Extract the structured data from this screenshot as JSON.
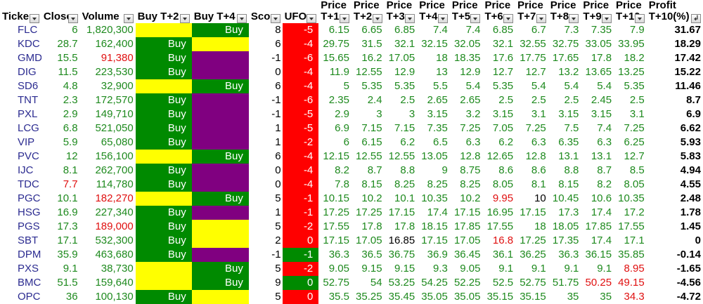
{
  "colors": {
    "buy_green": "#008a00",
    "empty_yellow": "#ffff00",
    "sell_purple": "#800080",
    "ufo_red": "#ff0000",
    "value_green": "#1e8a1e",
    "value_red": "#e01010"
  },
  "headers": {
    "ticker": "Ticker",
    "close": "Close",
    "volume": "Volume",
    "buy_t2": "Buy T+2",
    "buy_t4": "Buy T+4",
    "score": "Score",
    "ufo": "UFO",
    "price_top": "Price",
    "t1": "T+1",
    "t2": "T+2",
    "t3": "T+3",
    "t4": "T+4",
    "t5": "T+5",
    "t6": "T+6",
    "t7": "T+7",
    "t8": "T+8",
    "t9": "T+9",
    "t10": "T+10",
    "profit_top": "Profit",
    "profit_bottom": "T+10(%)"
  },
  "rows": [
    {
      "ticker": "FLC",
      "close": "6",
      "volume": "1,820,300",
      "b2": "",
      "b2c": "yellow",
      "b4": "Buy",
      "b4c": "green",
      "score": "8",
      "ufo": "-5",
      "ufoc": "red",
      "p": [
        "6.15",
        "6.65",
        "6.85",
        "7.4",
        "7.4",
        "6.85",
        "6.7",
        "7.3",
        "7.35",
        "7.9"
      ],
      "profit": "31.67"
    },
    {
      "ticker": "KDC",
      "close": "28.7",
      "volume": "162,400",
      "b2": "Buy",
      "b2c": "green",
      "b4": "",
      "b4c": "yellow",
      "score": "6",
      "ufo": "-4",
      "ufoc": "red",
      "p": [
        "29.75",
        "31.5",
        "32.1",
        "32.15",
        "32.05",
        "32.1",
        "32.55",
        "32.75",
        "33.05",
        "33.95"
      ],
      "profit": "18.29"
    },
    {
      "ticker": "GMD",
      "close": "15.5",
      "volume": "91,380",
      "volc": "red",
      "b2": "Buy",
      "b2c": "green",
      "b4": "",
      "b4c": "purple",
      "score": "-1",
      "ufo": "-6",
      "ufoc": "red",
      "p": [
        "15.65",
        "16.2",
        "17.05",
        "18",
        "18.35",
        "17.6",
        "17.75",
        "17.65",
        "17.8",
        "18.2"
      ],
      "profit": "17.42"
    },
    {
      "ticker": "DIG",
      "close": "11.5",
      "volume": "223,530",
      "b2": "Buy",
      "b2c": "green",
      "b4": "",
      "b4c": "purple",
      "score": "0",
      "ufo": "-4",
      "ufoc": "red",
      "p": [
        "11.9",
        "12.55",
        "12.9",
        "13",
        "12.9",
        "12.7",
        "12.7",
        "13.2",
        "13.65",
        "13.25"
      ],
      "profit": "15.22"
    },
    {
      "ticker": "SD6",
      "close": "4.8",
      "volume": "32,900",
      "b2": "",
      "b2c": "yellow",
      "b4": "Buy",
      "b4c": "green",
      "score": "6",
      "ufo": "-4",
      "ufoc": "red",
      "p": [
        "5",
        "5.35",
        "5.35",
        "5.5",
        "5.4",
        "5.35",
        "5.4",
        "5.4",
        "5.4",
        "5.35"
      ],
      "profit": "11.46"
    },
    {
      "ticker": "TNT",
      "close": "2.3",
      "volume": "172,570",
      "b2": "Buy",
      "b2c": "green",
      "b4": "",
      "b4c": "purple",
      "score": "-1",
      "ufo": "-6",
      "ufoc": "red",
      "p": [
        "2.35",
        "2.4",
        "2.5",
        "2.65",
        "2.65",
        "2.5",
        "2.5",
        "2.5",
        "2.45",
        "2.5"
      ],
      "profit": "8.7"
    },
    {
      "ticker": "PXL",
      "close": "2.9",
      "volume": "149,710",
      "b2": "Buy",
      "b2c": "green",
      "b4": "",
      "b4c": "purple",
      "score": "-1",
      "ufo": "-5",
      "ufoc": "red",
      "p": [
        "2.9",
        "3",
        "3",
        "3.15",
        "3.2",
        "3.15",
        "3.1",
        "3.15",
        "3.15",
        "3.1"
      ],
      "profit": "6.9"
    },
    {
      "ticker": "LCG",
      "close": "6.8",
      "volume": "521,050",
      "b2": "Buy",
      "b2c": "green",
      "b4": "",
      "b4c": "purple",
      "score": "1",
      "ufo": "-5",
      "ufoc": "red",
      "p": [
        "6.9",
        "7.15",
        "7.15",
        "7.35",
        "7.25",
        "7.05",
        "7.25",
        "7.5",
        "7.4",
        "7.25"
      ],
      "profit": "6.62"
    },
    {
      "ticker": "VIP",
      "close": "5.9",
      "volume": "65,080",
      "b2": "Buy",
      "b2c": "green",
      "b4": "",
      "b4c": "purple",
      "score": "1",
      "ufo": "-2",
      "ufoc": "red",
      "p": [
        "6",
        "6.15",
        "6.2",
        "6.5",
        "6.3",
        "6.2",
        "6.3",
        "6.35",
        "6.3",
        "6.25"
      ],
      "profit": "5.93"
    },
    {
      "ticker": "PVC",
      "close": "12",
      "volume": "156,100",
      "b2": "",
      "b2c": "yellow",
      "b4": "Buy",
      "b4c": "green",
      "score": "6",
      "ufo": "-4",
      "ufoc": "red",
      "p": [
        "12.15",
        "12.55",
        "12.55",
        "13.05",
        "12.8",
        "12.65",
        "12.8",
        "13.1",
        "13.1",
        "12.7"
      ],
      "profit": "5.83"
    },
    {
      "ticker": "IJC",
      "close": "8.1",
      "volume": "262,700",
      "b2": "Buy",
      "b2c": "green",
      "b4": "",
      "b4c": "purple",
      "score": "0",
      "ufo": "-4",
      "ufoc": "red",
      "p": [
        "8.2",
        "8.7",
        "8.8",
        "9",
        "8.75",
        "8.6",
        "8.6",
        "8.8",
        "8.7",
        "8.5"
      ],
      "profit": "4.94"
    },
    {
      "ticker": "TDC",
      "close": "7.7",
      "closec": "red",
      "volume": "114,780",
      "b2": "Buy",
      "b2c": "green",
      "b4": "",
      "b4c": "purple",
      "score": "0",
      "ufo": "-4",
      "ufoc": "red",
      "p": [
        "7.8",
        "8.15",
        "8.25",
        "8.25",
        "8.25",
        "8.05",
        "8.1",
        "8.15",
        "8.2",
        "8.05"
      ],
      "profit": "4.55"
    },
    {
      "ticker": "PGC",
      "close": "10.1",
      "volume": "182,270",
      "volc": "red",
      "b2": "",
      "b2c": "yellow",
      "b4": "Buy",
      "b4c": "green",
      "score": "5",
      "ufo": "-1",
      "ufoc": "red",
      "p": [
        "10.15",
        "10.2",
        "10.1",
        "10.35",
        "10.2",
        "9.95",
        "10",
        "10.45",
        "10.6",
        "10.35"
      ],
      "pc": {
        "5": "red",
        "6": "black"
      },
      "profit": "2.48"
    },
    {
      "ticker": "HSG",
      "close": "16.9",
      "volume": "227,340",
      "b2": "Buy",
      "b2c": "green",
      "b4": "",
      "b4c": "purple",
      "score": "1",
      "ufo": "-1",
      "ufoc": "red",
      "p": [
        "17.25",
        "17.25",
        "17.15",
        "17.4",
        "17.15",
        "16.95",
        "17.15",
        "17.3",
        "17.4",
        "17.2"
      ],
      "profit": "1.78"
    },
    {
      "ticker": "PGS",
      "close": "17.3",
      "volume": "189,000",
      "volc": "red",
      "b2": "Buy",
      "b2c": "green",
      "b4": "",
      "b4c": "yellow",
      "score": "5",
      "ufo": "-2",
      "ufoc": "red",
      "p": [
        "17.55",
        "17.8",
        "17.8",
        "18.15",
        "17.85",
        "17.55",
        "18",
        "18.05",
        "17.85",
        "17.55"
      ],
      "profit": "1.45"
    },
    {
      "ticker": "SBT",
      "close": "17.1",
      "volume": "532,300",
      "b2": "Buy",
      "b2c": "green",
      "b4": "",
      "b4c": "yellow",
      "score": "2",
      "ufo": "0",
      "ufoc": "red",
      "p": [
        "17.15",
        "17.05",
        "16.85",
        "17.15",
        "17.05",
        "16.8",
        "17.25",
        "17.35",
        "17.4",
        "17.1"
      ],
      "pc": {
        "2": "black",
        "5": "red"
      },
      "profit": "0"
    },
    {
      "ticker": "DPM",
      "close": "35.9",
      "volume": "463,680",
      "b2": "Buy",
      "b2c": "green",
      "b4": "",
      "b4c": "purple",
      "score": "-1",
      "ufo": "-1",
      "ufoc": "green",
      "p": [
        "36.3",
        "36.5",
        "36.75",
        "36.9",
        "36.45",
        "36.1",
        "36.25",
        "36.3",
        "36.15",
        "35.85"
      ],
      "profit": "-0.14"
    },
    {
      "ticker": "PXS",
      "close": "9.1",
      "volume": "38,730",
      "b2": "",
      "b2c": "yellow",
      "b4": "Buy",
      "b4c": "green",
      "score": "5",
      "ufo": "-2",
      "ufoc": "red",
      "p": [
        "9.05",
        "9.15",
        "9.15",
        "9.3",
        "9.05",
        "9.1",
        "9.1",
        "9.1",
        "9.1",
        "8.95"
      ],
      "pc": {
        "9": "red"
      },
      "profit": "-1.65"
    },
    {
      "ticker": "BMC",
      "close": "51.5",
      "volume": "159,640",
      "b2": "",
      "b2c": "yellow",
      "b4": "Buy",
      "b4c": "green",
      "score": "9",
      "ufo": "0",
      "ufoc": "green",
      "p": [
        "52.75",
        "54",
        "53.25",
        "54.25",
        "52.25",
        "52.5",
        "52.75",
        "51.75",
        "50.25",
        "49.15"
      ],
      "pc": {
        "8": "red",
        "9": "red"
      },
      "profit": "-4.56"
    },
    {
      "ticker": "OPC",
      "close": "36",
      "volume": "100,130",
      "b2": "Buy",
      "b2c": "green",
      "b4": "",
      "b4c": "yellow",
      "score": "5",
      "ufo": "0",
      "ufoc": "red",
      "p": [
        "35.5",
        "35.25",
        "35.45",
        "35.05",
        "35.05",
        "35.15",
        "35.15",
        "35",
        "35",
        "34.3"
      ],
      "pc": {
        "9": "red"
      },
      "profit": "-4.72"
    }
  ]
}
